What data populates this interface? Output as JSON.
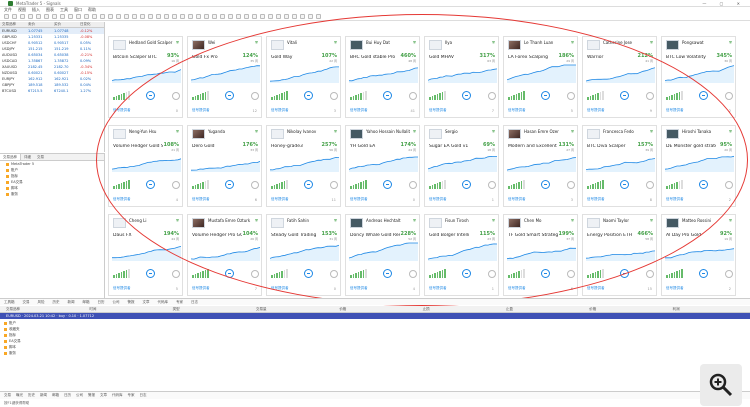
{
  "window": {
    "title": "MetaTrader 5 - Signals"
  },
  "menu": [
    "文件",
    "视图",
    "插入",
    "图表",
    "工具",
    "窗口",
    "帮助"
  ],
  "market": {
    "headers": [
      "交易品种",
      "卖价",
      "买价",
      "日变化"
    ],
    "rows": [
      [
        "EURUSD",
        "1.07745",
        "1.07748",
        "-0.12%"
      ],
      [
        "GBPUSD",
        "1.25331",
        "1.25335",
        "-0.08%"
      ],
      [
        "USDCHF",
        "0.90512",
        "0.90517",
        "0.05%"
      ],
      [
        "USDJPY",
        "151.215",
        "151.219",
        "0.11%"
      ],
      [
        "AUDUSD",
        "0.65034",
        "0.65038",
        "-0.21%"
      ],
      [
        "USDCAD",
        "1.35867",
        "1.35872",
        "0.09%"
      ],
      [
        "XAUUSD",
        "2182.45",
        "2182.70",
        "-0.34%"
      ],
      [
        "NZDUSD",
        "0.60021",
        "0.60027",
        "-0.15%"
      ],
      [
        "EURJPY",
        "162.912",
        "162.921",
        "0.02%"
      ],
      [
        "GBPJPY",
        "189.518",
        "189.532",
        "0.04%"
      ],
      [
        "BTCUSD",
        "67215.5",
        "67240.1",
        "1.27%"
      ]
    ]
  },
  "navigator": {
    "tabs": [
      "交易品种",
      "详细",
      "交易"
    ],
    "items": [
      "MetaTrader 5",
      "账户",
      "指标",
      "EA交易",
      "脚本",
      "服务"
    ]
  },
  "signals": [
    {
      "author": "Hedland Gold Scalper",
      "strategy": "Bitcoin Scalper BTC",
      "gain": "93%",
      "period": "16 周",
      "subs": "0"
    },
    {
      "author": "Wei",
      "strategy": "Gold Fx Pro",
      "gain": "124%",
      "period": "35 周",
      "subs": "12"
    },
    {
      "author": "Vitali",
      "strategy": "Gold Way",
      "gain": "107%",
      "period": "22 周",
      "subs": "3"
    },
    {
      "author": "Bui Huy Dat",
      "strategy": "BHC Gold stable Pro",
      "gain": "460%",
      "period": "48 周",
      "subs": "41"
    },
    {
      "author": "Ilya",
      "strategy": "Gold MHAV",
      "gain": "317%",
      "period": "63 周",
      "subs": "7"
    },
    {
      "author": "Le Thanh Luan",
      "strategy": "LA Forex Scalping",
      "gain": "186%",
      "period": "29 周",
      "subs": "5"
    },
    {
      "author": "Catherine Jose",
      "strategy": "Warrior",
      "gain": "212%",
      "period": "41 周",
      "subs": "9"
    },
    {
      "author": "Pongsawat",
      "strategy": "BTC Low Volatility",
      "gain": "345%",
      "period": "30 周",
      "subs": "2"
    },
    {
      "author": "Neng-Yun Hsu",
      "strategy": "Volume Hedger Gold Scalper",
      "gain": "108%",
      "period": "21 周",
      "subs": "4"
    },
    {
      "author": "Yuganda",
      "strategy": "Dero Gold",
      "gain": "176%",
      "period": "33 周",
      "subs": "6"
    },
    {
      "author": "Nikolay Ivanov",
      "strategy": "Honey-grade3",
      "gain": "257%",
      "period": "56 周",
      "subs": "11"
    },
    {
      "author": "Yahoo Hossain Nullality",
      "strategy": "YH Gold EA",
      "gain": "174%",
      "period": "24 周",
      "subs": "0"
    },
    {
      "author": "Sergio",
      "strategy": "Sugar EA Gold v1",
      "gain": "69%",
      "period": "18 周",
      "subs": "1"
    },
    {
      "author": "Hasan Emre Ozer",
      "strategy": "Modern and Excellent",
      "gain": "131%",
      "period": "27 周",
      "subs": "3"
    },
    {
      "author": "Francesca Fedo",
      "strategy": "BTC Diva Scalper",
      "gain": "157%",
      "period": "39 周",
      "subs": "8"
    },
    {
      "author": "Hiroshi Tanaka",
      "strategy": "DE Monster gold strategies 3",
      "gain": "95%",
      "period": "20 周",
      "subs": "2"
    },
    {
      "author": "Cheng Li",
      "strategy": "Daus FX",
      "gain": "194%",
      "period": "44 周",
      "subs": "5"
    },
    {
      "author": "Mustafa Emre Ozturk",
      "strategy": "Volume Hedger Pro GOLD BTC 4 Set",
      "gain": "104%",
      "period": "26 周",
      "subs": "7"
    },
    {
      "author": "Fatih Sahin",
      "strategy": "Steady Gold Trading",
      "gain": "153%",
      "period": "31 周",
      "subs": "0"
    },
    {
      "author": "Andreas Hechtalt",
      "strategy": "Doncy Whale Gold Research",
      "gain": "228%",
      "period": "52 周",
      "subs": "4"
    },
    {
      "author": "Fisun Tirosh",
      "strategy": "Gold Bolger Intelli",
      "gain": "115%",
      "period": "23 周",
      "subs": "1"
    },
    {
      "author": "Chen Mo",
      "strategy": "TF Gold Smart Strategies",
      "gain": "199%",
      "period": "37 周",
      "subs": "6"
    },
    {
      "author": "Naomi Taylor",
      "strategy": "Energy Position ETH",
      "gain": "466%",
      "period": "58 周",
      "subs": "15"
    },
    {
      "author": "Matteo Rossini",
      "strategy": "AI Day Pro Gold",
      "gain": "92%",
      "period": "19 周",
      "subs": "2"
    }
  ],
  "card_labels": {
    "subscribe": "信号提供者",
    "subscribers_suffix": "订阅者"
  },
  "status": [
    "工具箱",
    "交易",
    "风险",
    "历史",
    "新闻",
    "邮箱",
    "日历",
    "公司",
    "警报",
    "文章",
    "代码库",
    "专家",
    "日志"
  ],
  "terminal": {
    "headers": [
      "交易品种",
      "时间",
      "类型",
      "交易量",
      "价格",
      "止损",
      "止盈",
      "价格",
      "利润"
    ],
    "row": "EURUSD · 2024.03.21 10:42 · buy · 0.10 · 1.07712"
  },
  "tree": [
    "账户",
    "收藏夹",
    "指标",
    "EA交易",
    "脚本",
    "服务"
  ],
  "bottom_tabs": [
    "交易",
    "曝光",
    "历史",
    "新闻",
    "邮箱",
    "日历",
    "公司",
    "警报",
    "文章",
    "代码库",
    "专家",
    "日志"
  ],
  "statusbar": "按F1键获得帮助"
}
